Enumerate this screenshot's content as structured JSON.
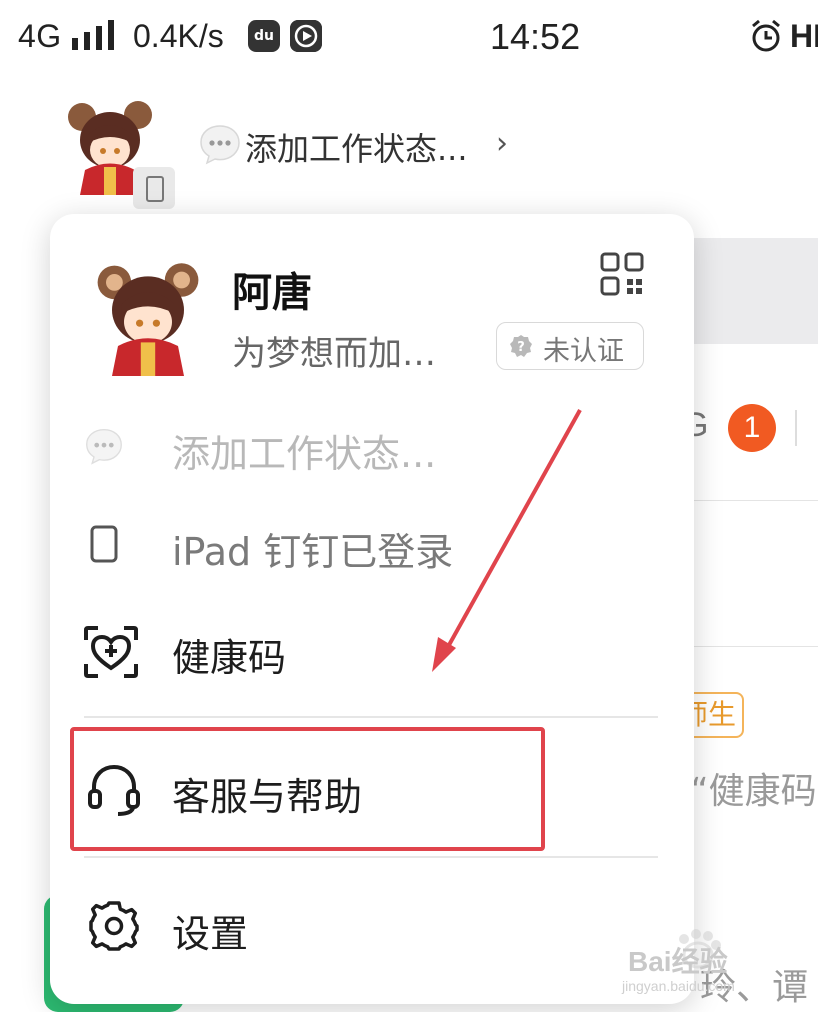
{
  "status_bar": {
    "network": "4G",
    "speed": "0.4K/s",
    "time": "14:52",
    "right_text": "HI"
  },
  "header": {
    "status_text": "添加工作状态...",
    "chevron": "›"
  },
  "background": {
    "g_letter": "G",
    "badge_count": "1",
    "tag_text": "师生",
    "snippet1": "“健康码",
    "snippet2": "玲、谭"
  },
  "profile_card": {
    "name": "阿唐",
    "slogan": "为梦想而加…",
    "verify_label": "未认证",
    "menu": [
      {
        "label": "添加工作状态...",
        "icon": "chat-bubble-icon"
      },
      {
        "label": "iPad 钉钉已登录",
        "icon": "tablet-icon"
      },
      {
        "label": "健康码",
        "icon": "health-code-icon"
      },
      {
        "label": "客服与帮助",
        "icon": "headset-icon"
      },
      {
        "label": "设置",
        "icon": "gear-icon"
      }
    ]
  },
  "watermark": {
    "text": "Bai经验",
    "url": "jingyan.baidu.com"
  },
  "colors": {
    "highlight": "#e0444c",
    "badge": "#f15a22",
    "tag": "#e89a2c",
    "green": "#2dbb72"
  }
}
